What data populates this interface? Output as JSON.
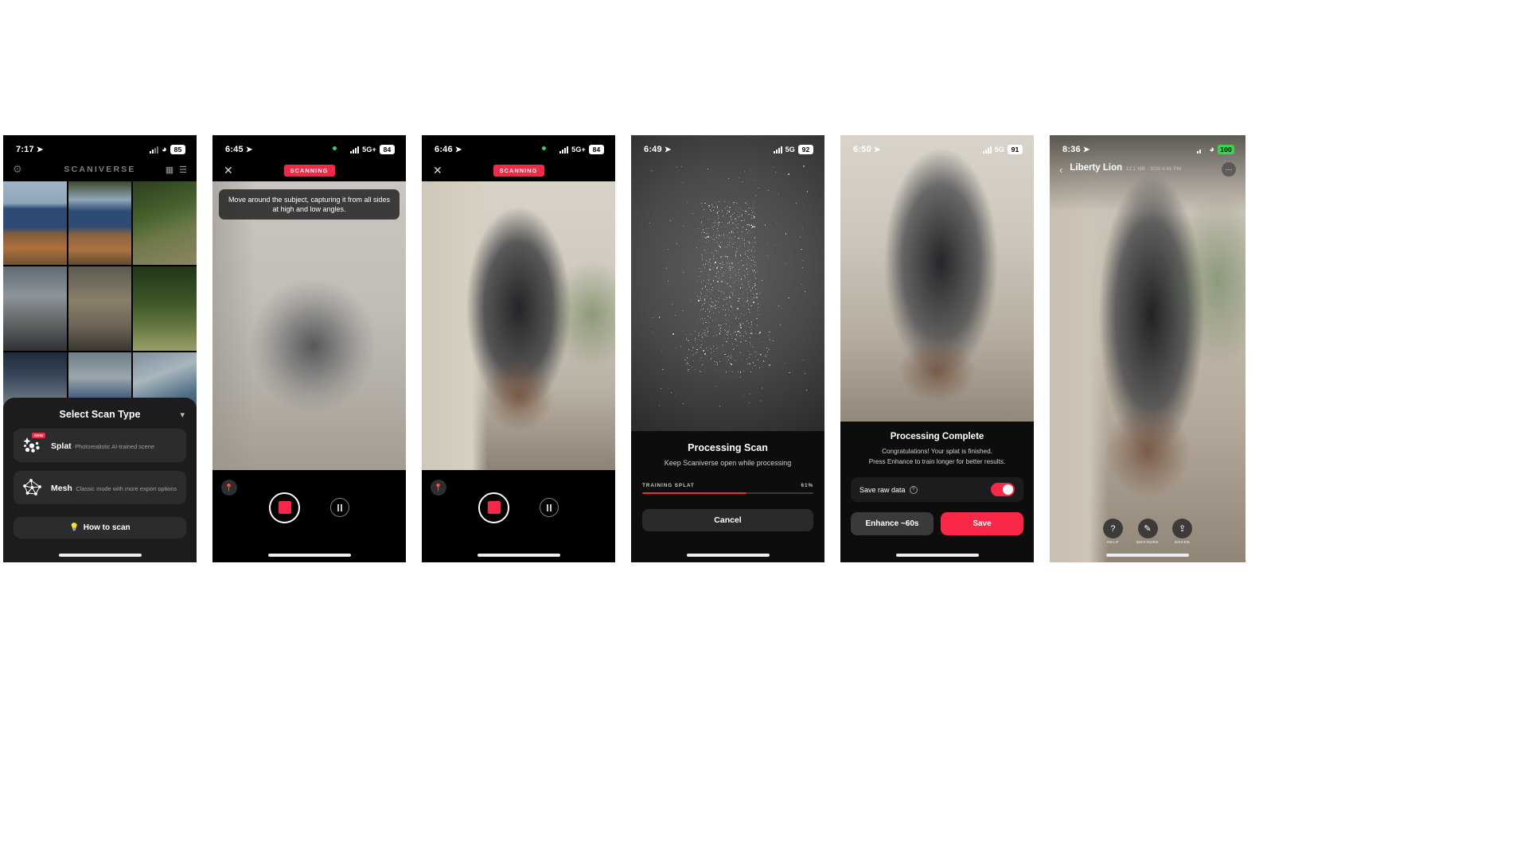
{
  "app": {
    "name": "Scaniverse",
    "accent": "#fa2846"
  },
  "phones": [
    {
      "id": "gallery",
      "status": {
        "time": "7:17",
        "location_icon": "location-arrow-icon",
        "network": "",
        "wifi": "wifi-icon",
        "battery": "85"
      },
      "header": {
        "title": "SCANIVERSE",
        "settings_icon": "gear-icon",
        "grid_view_icon": "grid-view-icon",
        "list_view_icon": "list-view-icon"
      },
      "sheet": {
        "title": "Select Scan Type",
        "collapse_icon": "chevron-down-icon",
        "options": [
          {
            "name": "Splat",
            "desc": "Photorealistic AI-trained scene",
            "badge": "NEW",
            "icon": "splat-icon"
          },
          {
            "name": "Mesh",
            "desc": "Classic mode with more export options",
            "badge": "",
            "icon": "mesh-icon"
          }
        ],
        "how_to": {
          "label": "How to scan",
          "icon": "lightbulb-icon"
        }
      }
    },
    {
      "id": "scanning-start",
      "status": {
        "time": "6:45",
        "location_icon": "location-arrow-icon",
        "network": "5G+",
        "battery": "84"
      },
      "topbar": {
        "close_icon": "close-icon",
        "badge": "SCANNING"
      },
      "tip": "Move around the subject, capturing it from all sides at high and low angles.",
      "pin_icon": "map-pin-icon",
      "controls": {
        "record_icon": "stop-record-icon",
        "pause_icon": "pause-icon"
      }
    },
    {
      "id": "scanning-progress",
      "status": {
        "time": "6:46",
        "location_icon": "location-arrow-icon",
        "network": "5G+",
        "battery": "84"
      },
      "topbar": {
        "close_icon": "close-icon",
        "badge": "SCANNING"
      },
      "tip": "",
      "pin_icon": "map-pin-icon",
      "controls": {
        "record_icon": "stop-record-icon",
        "pause_icon": "pause-icon"
      }
    },
    {
      "id": "processing",
      "status": {
        "time": "6:49",
        "location_icon": "location-arrow-icon",
        "network": "5G",
        "battery": "92"
      },
      "panel": {
        "title": "Processing Scan",
        "subtitle": "Keep Scaniverse open while processing",
        "progress_label": "TRAINING SPLAT",
        "progress_value": "61%",
        "progress_percent": 61,
        "cancel_label": "Cancel"
      }
    },
    {
      "id": "complete",
      "status": {
        "time": "6:50",
        "location_icon": "location-arrow-icon",
        "network": "5G",
        "battery": "91"
      },
      "panel": {
        "title": "Processing Complete",
        "line1": "Congratulations! Your splat is finished.",
        "line2": "Press Enhance to train longer for better results.",
        "raw_label": "Save raw data",
        "raw_help_icon": "question-mark-icon",
        "raw_enabled": true,
        "enhance_label": "Enhance  ~60s",
        "save_label": "Save"
      }
    },
    {
      "id": "viewer",
      "status": {
        "time": "8:36",
        "location_icon": "location-arrow-icon",
        "network": "",
        "wifi": "wifi-icon",
        "battery": "100"
      },
      "header": {
        "back_icon": "chevron-left-icon",
        "title": "Liberty Lion",
        "subtitle": "12.1 MB · 3/28 4:46 PM",
        "more_icon": "ellipsis-icon"
      },
      "tools": [
        {
          "label": "HELP",
          "icon": "question-mark-icon"
        },
        {
          "label": "MEASURE",
          "icon": "pencil-icon"
        },
        {
          "label": "SHARE",
          "icon": "share-icon"
        }
      ]
    }
  ]
}
